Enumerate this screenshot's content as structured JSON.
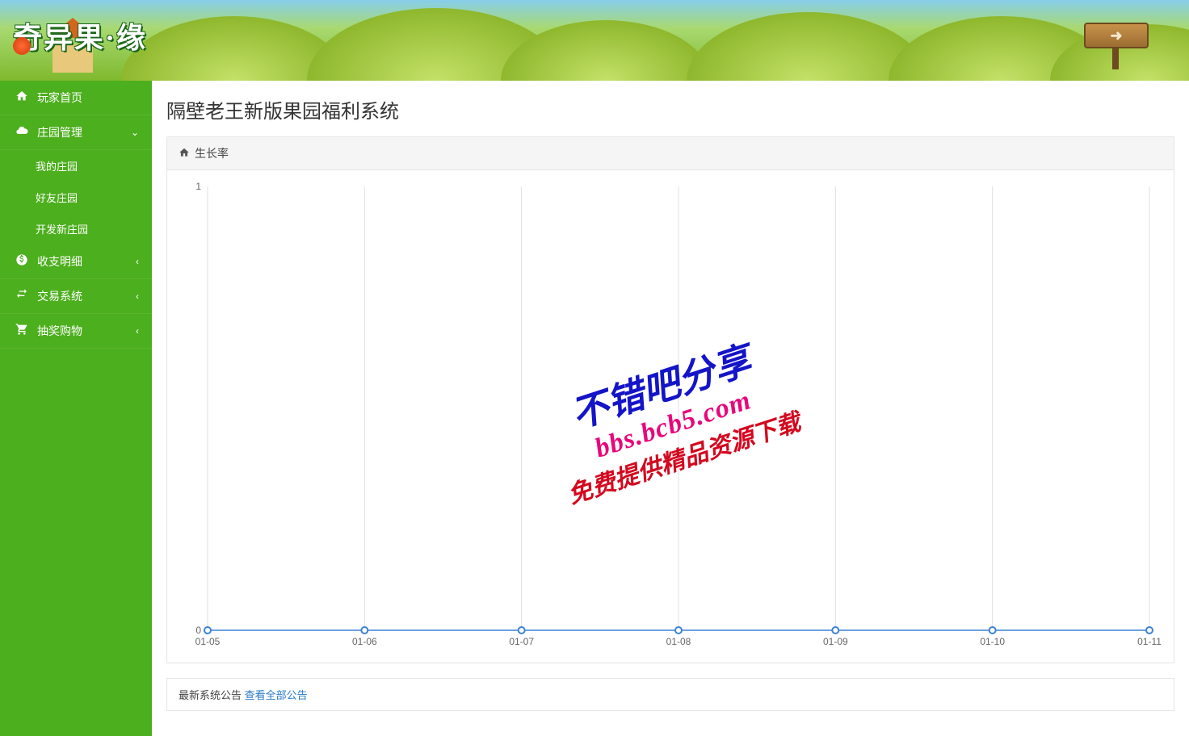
{
  "logo_text": "奇异果·缘",
  "page_title": "隔壁老王新版果园福利系统",
  "sidebar": {
    "items": [
      {
        "icon": "home",
        "label": "玩家首页",
        "expand": null
      },
      {
        "icon": "cloud",
        "label": "庄园管理",
        "expand": "open"
      },
      {
        "icon": "dollar",
        "label": "收支明细",
        "expand": "closed"
      },
      {
        "icon": "exchange",
        "label": "交易系统",
        "expand": "closed"
      },
      {
        "icon": "cart",
        "label": "抽奖购物",
        "expand": "closed"
      }
    ],
    "sub_items": [
      {
        "label": "我的庄园"
      },
      {
        "label": "好友庄园"
      },
      {
        "label": "开发新庄园"
      }
    ]
  },
  "panel": {
    "title": "生长率"
  },
  "chart_data": {
    "type": "line",
    "categories": [
      "01-05",
      "01-06",
      "01-07",
      "01-08",
      "01-09",
      "01-10",
      "01-11"
    ],
    "values": [
      0,
      0,
      0,
      0,
      0,
      0,
      0
    ],
    "title": "",
    "xlabel": "",
    "ylabel": "",
    "ylim": [
      0,
      1
    ],
    "yticks": [
      0,
      1
    ]
  },
  "watermark": {
    "line1": "不错吧分享",
    "line2": "bbs.bcb5.com",
    "line3": "免费提供精品资源下载"
  },
  "notice": {
    "prefix": "最新系统公告",
    "link": "查看全部公告"
  }
}
